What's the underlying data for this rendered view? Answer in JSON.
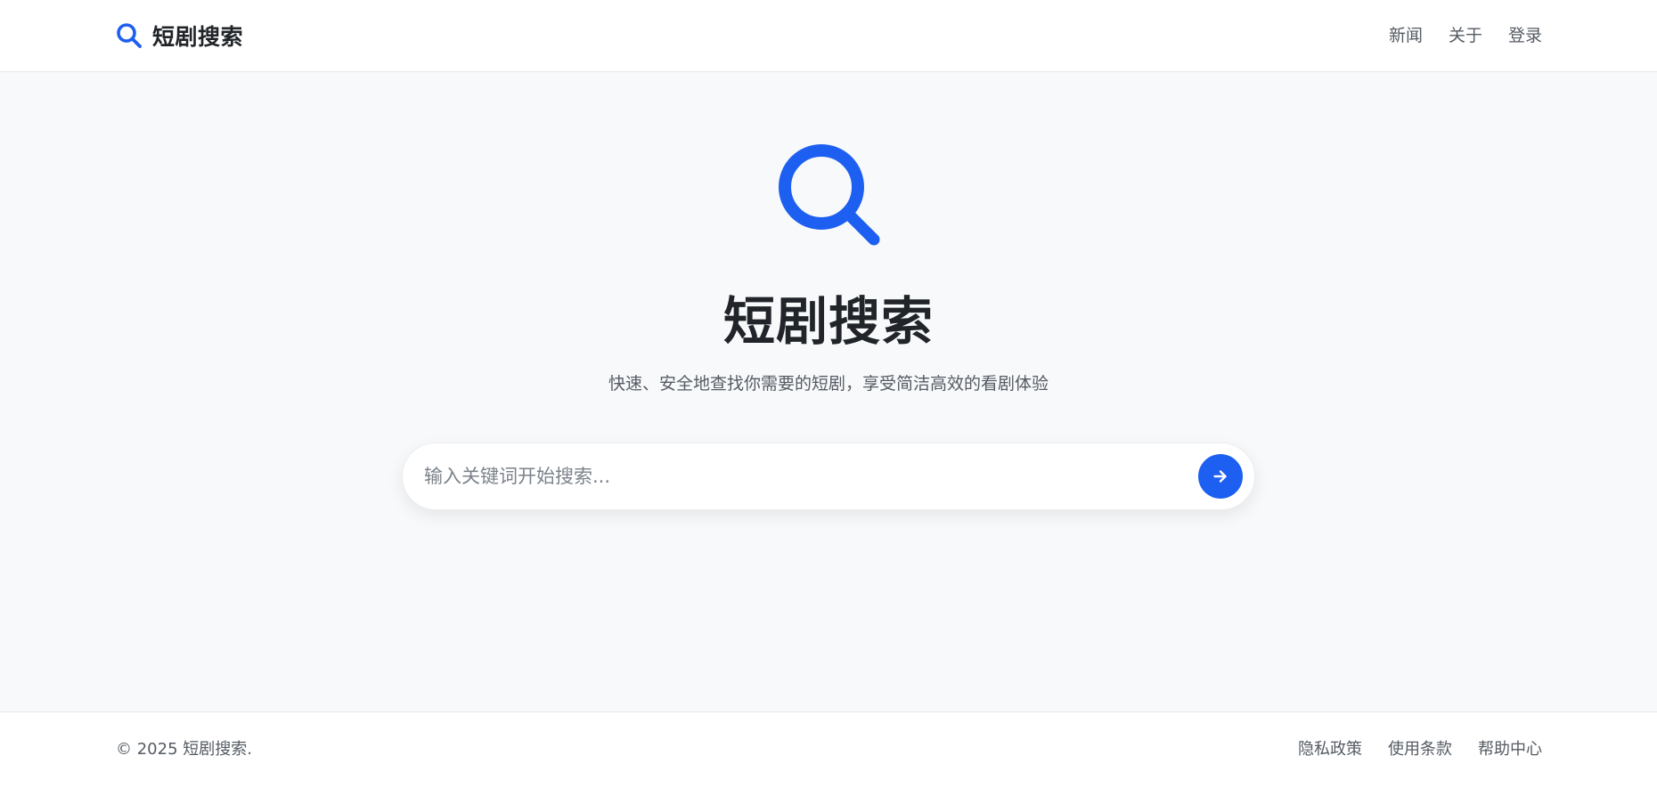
{
  "header": {
    "brand_name": "短剧搜索",
    "nav": [
      "新闻",
      "关于",
      "登录"
    ]
  },
  "hero": {
    "title": "短剧搜索",
    "subtitle": "快速、安全地查找你需要的短剧，享受简洁高效的看剧体验"
  },
  "search": {
    "placeholder": "输入关键词开始搜索...",
    "value": ""
  },
  "footer": {
    "copyright": "© 2025 短剧搜索.",
    "links": [
      "隐私政策",
      "使用条款",
      "帮助中心"
    ]
  },
  "colors": {
    "accent": "#1d5ff0",
    "text": "#212529",
    "muted": "#555b63",
    "background": "#f8f9fb"
  },
  "icons": {
    "brand": "search-icon",
    "hero": "search-icon",
    "submit": "arrow-right-icon"
  }
}
